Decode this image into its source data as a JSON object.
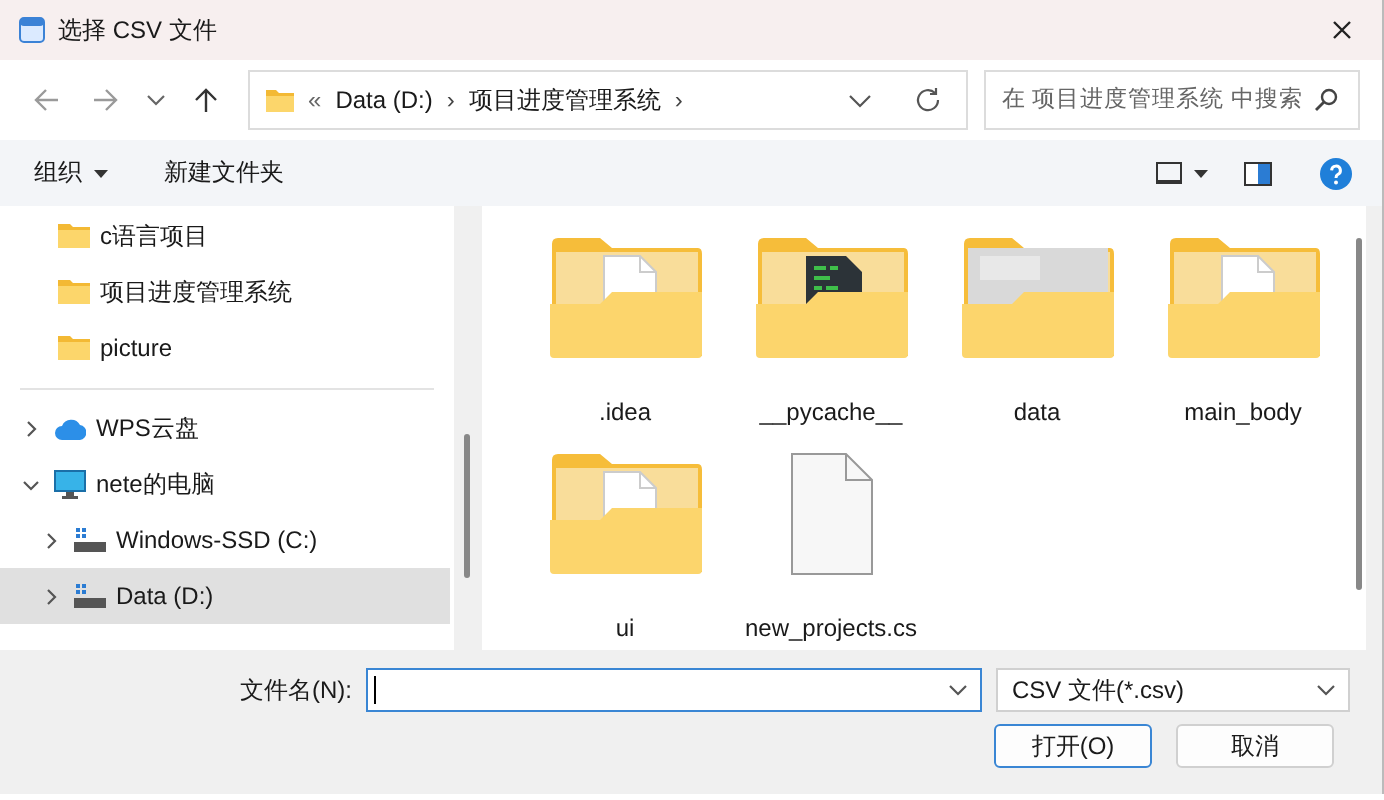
{
  "window": {
    "title": "选择 CSV 文件"
  },
  "nav": {
    "back_disabled": true,
    "forward_disabled": true
  },
  "address": {
    "overflow": "«",
    "crumbs": [
      {
        "label": "Data (D:)",
        "separator": "›"
      },
      {
        "label": "项目进度管理系统",
        "separator": "›"
      }
    ]
  },
  "search": {
    "placeholder": "在 项目进度管理系统 中搜索"
  },
  "toolbar": {
    "organize": "组织",
    "new_folder": "新建文件夹"
  },
  "sidebar": {
    "items": [
      {
        "kind": "folder",
        "label": "c语言项目",
        "selected": false
      },
      {
        "kind": "folder",
        "label": "项目进度管理系统",
        "selected": false
      },
      {
        "kind": "folder",
        "label": "picture",
        "selected": false
      },
      {
        "kind": "divider"
      },
      {
        "kind": "cloud",
        "label": "WPS云盘",
        "expanded": false,
        "selected": false
      },
      {
        "kind": "computer",
        "label": "nete的电脑",
        "expanded": true,
        "selected": false,
        "children": [
          {
            "kind": "drive",
            "label": "Windows-SSD (C:)",
            "expanded": false,
            "selected": false
          },
          {
            "kind": "drive",
            "label": "Data (D:)",
            "expanded": false,
            "selected": true
          }
        ]
      }
    ]
  },
  "files": [
    {
      "kind": "docfolder",
      "name": ".idea"
    },
    {
      "kind": "codefolder",
      "name": "__pycache__"
    },
    {
      "kind": "imagefolder",
      "name": "data"
    },
    {
      "kind": "docfolder",
      "name": "main_body"
    },
    {
      "kind": "docfolder",
      "name": "ui"
    },
    {
      "kind": "file",
      "name": "new_projects.cs"
    }
  ],
  "filename": {
    "label": "文件名(N):"
  },
  "filetype": {
    "value": "CSV 文件(*.csv)"
  },
  "buttons": [
    {
      "label": "打开(O)",
      "kind": "primary"
    },
    {
      "label": "取消",
      "kind": "secondary"
    }
  ]
}
